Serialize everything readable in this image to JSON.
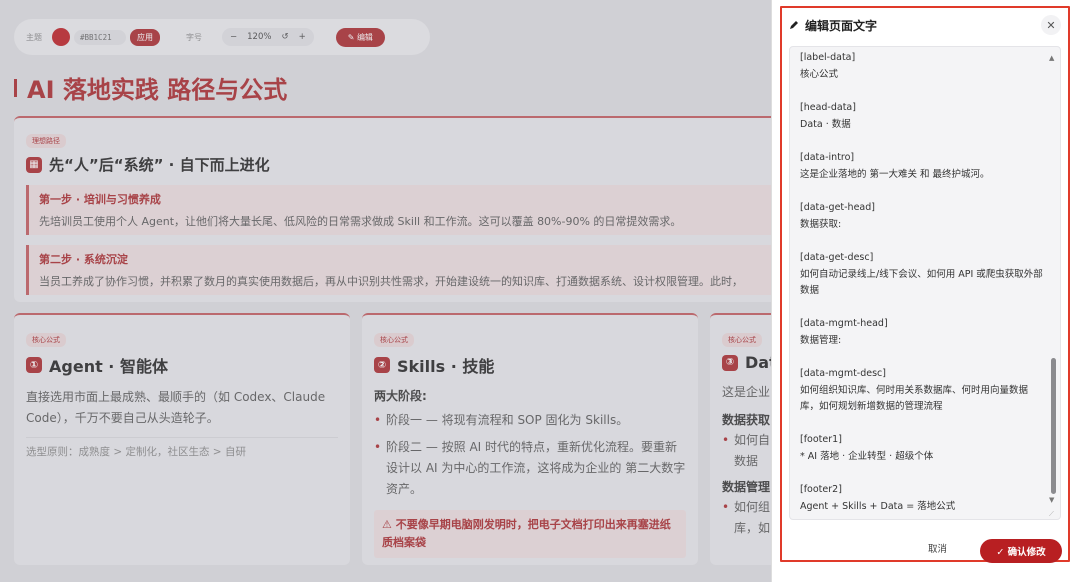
{
  "toolbar": {
    "theme_label": "主题",
    "theme_color": "#BB1C21",
    "apply_label": "应用",
    "font_label": "字号",
    "minus": "−",
    "zoom": "120%",
    "reset": "↺",
    "plus": "+",
    "edit_label": "编辑"
  },
  "page_title": "AI 落地实践 路径与公式",
  "path_card": {
    "tag": "理想路径",
    "title": "先“人”后“系统” · 自下而上进化",
    "steps": [
      {
        "head": "第一步 · 培训与习惯养成",
        "desc": "先培训员工使用个人 Agent，让他们将大量长尾、低风险的日常需求做成 Skill 和工作流。这可以覆盖 80%-90% 的日常提效需求。"
      },
      {
        "head": "第二步 · 系统沉淀",
        "desc": "当员工养成了协作习惯，并积累了数月的真实使用数据后，再从中识别共性需求，开始建设统一的知识库、打通数据系统、设计权限管理。此时，"
      }
    ]
  },
  "cards": [
    {
      "tag": "核心公式",
      "num": "①",
      "title": "Agent · 智能体",
      "body": "直接选用市面上最成熟、最顺手的（如 Codex、Claude Code），千万不要自己从头造轮子。",
      "sub": "选型原则：成熟度 > 定制化，社区生态 > 自研"
    },
    {
      "tag": "核心公式",
      "num": "②",
      "title": "Skills · 技能",
      "heading": "两大阶段:",
      "bullets": [
        "阶段一 — 将现有流程和 SOP 固化为 Skills。",
        "阶段二 — 按照 AI 时代的特点，重新优化流程。要重新设计以 AI 为中心的工作流，这将成为企业的 第二大数字资产。"
      ],
      "warn": "⚠ 不要像早期电脑刚发明时，把电子文档打印出来再塞进纸质档案袋"
    },
    {
      "tag": "核心公式",
      "num": "③",
      "title": "Dat",
      "body": "这是企业",
      "h1": "数据获取",
      "b1": "如何自",
      "b1b": "数据",
      "h2": "数据管理",
      "b2": "如何组",
      "b2b": "库，如"
    }
  ],
  "modal": {
    "title": "编辑页面文字",
    "close": "✕",
    "entries": [
      {
        "key": "[label-data]",
        "value": "核心公式"
      },
      {
        "key": "[head-data]",
        "value": "Data · 数据"
      },
      {
        "key": "[data-intro]",
        "value": "这是企业落地的 第一大难关 和 最终护城河。"
      },
      {
        "key": "[data-get-head]",
        "value": "数据获取:"
      },
      {
        "key": "[data-get-desc]",
        "value": "如何自动记录线上/线下会议、如何用 API 或爬虫获取外部数据"
      },
      {
        "key": "[data-mgmt-head]",
        "value": "数据管理:"
      },
      {
        "key": "[data-mgmt-desc]",
        "value": "如何组织知识库、何时用关系数据库、何时用向量数据库，如何规划新增数据的管理流程"
      },
      {
        "key": "[footer1]",
        "value": "* AI 落地 · 企业转型 · 超级个体"
      },
      {
        "key": "[footer2]",
        "value": "Agent + Skills + Data = 落地公式"
      }
    ],
    "cancel_label": "取消",
    "confirm_label": "✓ 确认修改"
  }
}
